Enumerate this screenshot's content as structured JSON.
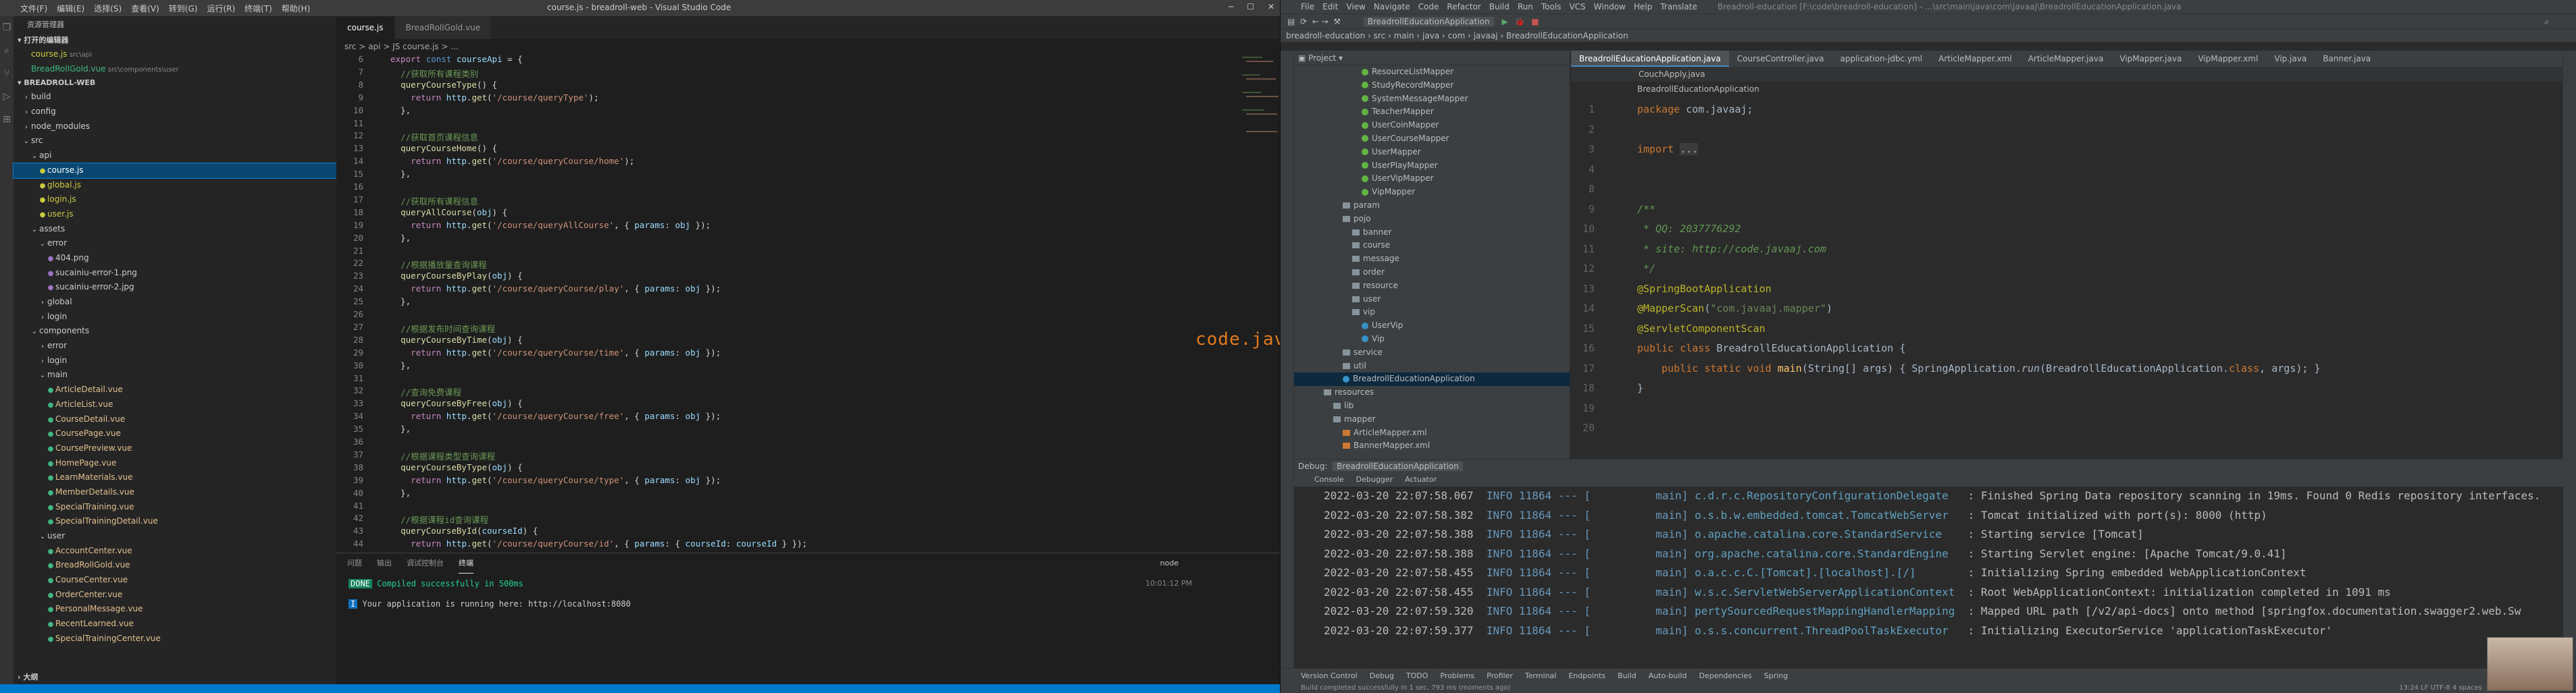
{
  "vscode": {
    "menu": [
      "文件(F)",
      "编辑(E)",
      "选择(S)",
      "查看(V)",
      "转到(G)",
      "运行(R)",
      "终端(T)",
      "帮助(H)"
    ],
    "window_title": "course.js - breadroll-web - Visual Studio Code",
    "explorer_title": "资源管理器",
    "open_editors": "打开的编辑器",
    "open_files": [
      {
        "name": "course.js",
        "path": "src\\api"
      },
      {
        "name": "BreadRollGold.vue",
        "path": "src\\components\\user"
      }
    ],
    "project": "BREADROLL-WEB",
    "tree": [
      {
        "l": "build",
        "d": 1,
        "t": "f"
      },
      {
        "l": "config",
        "d": 1,
        "t": "f"
      },
      {
        "l": "node_modules",
        "d": 1,
        "t": "f"
      },
      {
        "l": "src",
        "d": 1,
        "t": "fo"
      },
      {
        "l": "api",
        "d": 2,
        "t": "fo"
      },
      {
        "l": "course.js",
        "d": 3,
        "t": "js",
        "sel": true
      },
      {
        "l": "global.js",
        "d": 3,
        "t": "js"
      },
      {
        "l": "login.js",
        "d": 3,
        "t": "js"
      },
      {
        "l": "user.js",
        "d": 3,
        "t": "js"
      },
      {
        "l": "assets",
        "d": 2,
        "t": "fo"
      },
      {
        "l": "error",
        "d": 3,
        "t": "fo"
      },
      {
        "l": "404.png",
        "d": 4,
        "t": "img"
      },
      {
        "l": "sucainiu-error-1.png",
        "d": 4,
        "t": "img"
      },
      {
        "l": "sucainiu-error-2.jpg",
        "d": 4,
        "t": "img"
      },
      {
        "l": "global",
        "d": 3,
        "t": "f"
      },
      {
        "l": "login",
        "d": 3,
        "t": "f"
      },
      {
        "l": "components",
        "d": 2,
        "t": "fo"
      },
      {
        "l": "error",
        "d": 3,
        "t": "f"
      },
      {
        "l": "login",
        "d": 3,
        "t": "f"
      },
      {
        "l": "main",
        "d": 3,
        "t": "fo"
      },
      {
        "l": "ArticleDetail.vue",
        "d": 4,
        "t": "vue"
      },
      {
        "l": "ArticleList.vue",
        "d": 4,
        "t": "vue"
      },
      {
        "l": "CourseDetail.vue",
        "d": 4,
        "t": "vue"
      },
      {
        "l": "CoursePage.vue",
        "d": 4,
        "t": "vue"
      },
      {
        "l": "CoursePreview.vue",
        "d": 4,
        "t": "vue"
      },
      {
        "l": "HomePage.vue",
        "d": 4,
        "t": "vue"
      },
      {
        "l": "LearnMaterials.vue",
        "d": 4,
        "t": "vue"
      },
      {
        "l": "MemberDetails.vue",
        "d": 4,
        "t": "vue"
      },
      {
        "l": "SpecialTraining.vue",
        "d": 4,
        "t": "vue"
      },
      {
        "l": "SpecialTrainingDetail.vue",
        "d": 4,
        "t": "vue"
      },
      {
        "l": "user",
        "d": 3,
        "t": "fo"
      },
      {
        "l": "AccountCenter.vue",
        "d": 4,
        "t": "vue"
      },
      {
        "l": "BreadRollGold.vue",
        "d": 4,
        "t": "vue"
      },
      {
        "l": "CourseCenter.vue",
        "d": 4,
        "t": "vue"
      },
      {
        "l": "OrderCenter.vue",
        "d": 4,
        "t": "vue"
      },
      {
        "l": "PersonalMessage.vue",
        "d": 4,
        "t": "vue"
      },
      {
        "l": "RecentLearned.vue",
        "d": 4,
        "t": "vue"
      },
      {
        "l": "SpecialTrainingCenter.vue",
        "d": 4,
        "t": "vue"
      }
    ],
    "outline": "大纲",
    "tabs": [
      {
        "name": "course.js",
        "active": true
      },
      {
        "name": "BreadRollGold.vue",
        "active": false
      }
    ],
    "breadcrumb": "src > api > JS course.js > ...",
    "code": [
      {
        "n": "6",
        "h": "<span class='kw'>export</span> <span class='kw2'>const</span> <span class='var'>courseApi</span> = {"
      },
      {
        "n": "7",
        "h": "  <span class='cm'>//获取所有课程类别</span>"
      },
      {
        "n": "8",
        "h": "  <span class='fn'>queryCourseType</span>() {"
      },
      {
        "n": "9",
        "h": "    <span class='kw'>return</span> <span class='var'>http</span>.<span class='fn'>get</span>(<span class='str'>'/course/queryType'</span>);"
      },
      {
        "n": "10",
        "h": "  },"
      },
      {
        "n": "11",
        "h": ""
      },
      {
        "n": "12",
        "h": "  <span class='cm'>//获取首页课程信息</span>"
      },
      {
        "n": "13",
        "h": "  <span class='fn'>queryCourseHome</span>() {"
      },
      {
        "n": "14",
        "h": "    <span class='kw'>return</span> <span class='var'>http</span>.<span class='fn'>get</span>(<span class='str'>'/course/queryCourse/home'</span>);"
      },
      {
        "n": "15",
        "h": "  },"
      },
      {
        "n": "16",
        "h": ""
      },
      {
        "n": "17",
        "h": "  <span class='cm'>//获取所有课程信息</span>"
      },
      {
        "n": "18",
        "h": "  <span class='fn'>queryAllCourse</span>(<span class='var'>obj</span>) {"
      },
      {
        "n": "19",
        "h": "    <span class='kw'>return</span> <span class='var'>http</span>.<span class='fn'>get</span>(<span class='str'>'/course/queryAllCourse'</span>, { <span class='var'>params</span>: <span class='var'>obj</span> });"
      },
      {
        "n": "20",
        "h": "  },"
      },
      {
        "n": "21",
        "h": ""
      },
      {
        "n": "22",
        "h": "  <span class='cm'>//根据播放量查询课程</span>"
      },
      {
        "n": "23",
        "h": "  <span class='fn'>queryCourseByPlay</span>(<span class='var'>obj</span>) {"
      },
      {
        "n": "24",
        "h": "    <span class='kw'>return</span> <span class='var'>http</span>.<span class='fn'>get</span>(<span class='str'>'/course/queryCourse/play'</span>, { <span class='var'>params</span>: <span class='var'>obj</span> });"
      },
      {
        "n": "25",
        "h": "  },"
      },
      {
        "n": "26",
        "h": ""
      },
      {
        "n": "27",
        "h": "  <span class='cm'>//根据发布时间查询课程</span>"
      },
      {
        "n": "28",
        "h": "  <span class='fn'>queryCourseByTime</span>(<span class='var'>obj</span>) {"
      },
      {
        "n": "29",
        "h": "    <span class='kw'>return</span> <span class='var'>http</span>.<span class='fn'>get</span>(<span class='str'>'/course/queryCourse/time'</span>, { <span class='var'>params</span>: <span class='var'>obj</span> });"
      },
      {
        "n": "30",
        "h": "  },"
      },
      {
        "n": "31",
        "h": ""
      },
      {
        "n": "32",
        "h": "  <span class='cm'>//查询免费课程</span>"
      },
      {
        "n": "33",
        "h": "  <span class='fn'>queryCourseByFree</span>(<span class='var'>obj</span>) {"
      },
      {
        "n": "34",
        "h": "    <span class='kw'>return</span> <span class='var'>http</span>.<span class='fn'>get</span>(<span class='str'>'/course/queryCourse/free'</span>, { <span class='var'>params</span>: <span class='var'>obj</span> });"
      },
      {
        "n": "35",
        "h": "  },"
      },
      {
        "n": "36",
        "h": ""
      },
      {
        "n": "37",
        "h": "  <span class='cm'>//根据课程类型查询课程</span>"
      },
      {
        "n": "38",
        "h": "  <span class='fn'>queryCourseByType</span>(<span class='var'>obj</span>) {"
      },
      {
        "n": "39",
        "h": "    <span class='kw'>return</span> <span class='var'>http</span>.<span class='fn'>get</span>(<span class='str'>'/course/queryCourse/type'</span>, { <span class='var'>params</span>: <span class='var'>obj</span> });"
      },
      {
        "n": "40",
        "h": "  },"
      },
      {
        "n": "41",
        "h": ""
      },
      {
        "n": "42",
        "h": "  <span class='cm'>//根据课程id查询课程</span>"
      },
      {
        "n": "43",
        "h": "  <span class='fn'>queryCourseById</span>(<span class='var'>courseId</span>) {"
      },
      {
        "n": "44",
        "h": "    <span class='kw'>return</span> <span class='var'>http</span>.<span class='fn'>get</span>(<span class='str'>'/course/queryCourse/id'</span>, { <span class='var'>params</span>: { <span class='var'>courseId</span>: <span class='var'>courseId</span> } });"
      }
    ],
    "panel_tabs": [
      "问题",
      "输出",
      "调试控制台",
      "终端"
    ],
    "terminal_name": "node",
    "terminal_time": "10:01:12 PM",
    "done_badge": "DONE",
    "compiled": "Compiled successfully in 500ms",
    "info_badge": "I",
    "running": "Your application is running here: http://localhost:8080"
  },
  "watermark": "code.javaaj.com",
  "idea": {
    "menu": [
      "File",
      "Edit",
      "View",
      "Navigate",
      "Code",
      "Refactor",
      "Build",
      "Run",
      "Tools",
      "VCS",
      "Window",
      "Help",
      "Translate"
    ],
    "path": "Breadroll-education [F:\\code\\breadroll-education] - ...\\src\\main\\java\\com\\javaaj\\BreadrollEducationApplication.java",
    "run_config": "BreadrollEducationApplication",
    "breadcrumb": [
      "breadroll-education",
      "src",
      "main",
      "java",
      "com",
      "javaaj",
      "BreadrollEducationApplication"
    ],
    "project_label": "Project",
    "tree": [
      {
        "l": "ResourceListMapper",
        "d": 5,
        "t": "i"
      },
      {
        "l": "StudyRecordMapper",
        "d": 5,
        "t": "i"
      },
      {
        "l": "SystemMessageMapper",
        "d": 5,
        "t": "i"
      },
      {
        "l": "TeacherMapper",
        "d": 5,
        "t": "i"
      },
      {
        "l": "UserCoinMapper",
        "d": 5,
        "t": "i"
      },
      {
        "l": "UserCourseMapper",
        "d": 5,
        "t": "i"
      },
      {
        "l": "UserMapper",
        "d": 5,
        "t": "i"
      },
      {
        "l": "UserPlayMapper",
        "d": 5,
        "t": "i"
      },
      {
        "l": "UserVipMapper",
        "d": 5,
        "t": "i"
      },
      {
        "l": "VipMapper",
        "d": 5,
        "t": "i"
      },
      {
        "l": "param",
        "d": 3,
        "t": "f"
      },
      {
        "l": "pojo",
        "d": 3,
        "t": "f"
      },
      {
        "l": "banner",
        "d": 4,
        "t": "f"
      },
      {
        "l": "course",
        "d": 4,
        "t": "f"
      },
      {
        "l": "message",
        "d": 4,
        "t": "f"
      },
      {
        "l": "order",
        "d": 4,
        "t": "f"
      },
      {
        "l": "resource",
        "d": 4,
        "t": "f"
      },
      {
        "l": "user",
        "d": 4,
        "t": "f"
      },
      {
        "l": "vip",
        "d": 4,
        "t": "f"
      },
      {
        "l": "UserVip",
        "d": 5,
        "t": "c"
      },
      {
        "l": "Vip",
        "d": 5,
        "t": "c"
      },
      {
        "l": "service",
        "d": 3,
        "t": "f"
      },
      {
        "l": "util",
        "d": 3,
        "t": "f"
      },
      {
        "l": "BreadrollEducationApplication",
        "d": 3,
        "t": "c",
        "sel": true
      },
      {
        "l": "resources",
        "d": 1,
        "t": "f"
      },
      {
        "l": "lib",
        "d": 2,
        "t": "f"
      },
      {
        "l": "mapper",
        "d": 2,
        "t": "f"
      },
      {
        "l": "ArticleMapper.xml",
        "d": 3,
        "t": "x"
      },
      {
        "l": "BannerMapper.xml",
        "d": 3,
        "t": "x"
      }
    ],
    "tabs": [
      {
        "n": "BreadrollEducationApplication.java",
        "on": true
      },
      {
        "n": "CourseController.java"
      },
      {
        "n": "application-jdbc.yml"
      },
      {
        "n": "ArticleMapper.xml"
      },
      {
        "n": "ArticleMapper.java"
      },
      {
        "n": "VipMapper.java"
      },
      {
        "n": "VipMapper.xml"
      },
      {
        "n": "Vip.java"
      },
      {
        "n": "Banner.java"
      }
    ],
    "subtab": "CouchApply.java",
    "class_header": "BreadrollEducationApplication",
    "code": [
      {
        "n": "1",
        "h": "<span class='ikw'>package</span> com.javaaj;"
      },
      {
        "n": "2",
        "h": ""
      },
      {
        "n": "3",
        "h": "<span class='ikw'>import</span> <span style='background:#3b3b3b'>...</span>"
      },
      {
        "n": "4",
        "h": ""
      },
      {
        "n": "8",
        "h": ""
      },
      {
        "n": "9",
        "h": "<span class='icm'>/**</span>"
      },
      {
        "n": "10",
        "h": "<span class='icm'> * QQ: 2037776292</span>"
      },
      {
        "n": "11",
        "h": "<span class='icm'> * site: http://code.javaaj.com</span>"
      },
      {
        "n": "12",
        "h": "<span class='icm'> */</span>"
      },
      {
        "n": "13",
        "h": "<span class='iann'>@SpringBootApplication</span>"
      },
      {
        "n": "14",
        "h": "<span class='iann'>@MapperScan</span>(<span class='istr'>\"com.javaaj.mapper\"</span>)"
      },
      {
        "n": "15",
        "h": "<span class='iann'>@ServletComponentScan</span>"
      },
      {
        "n": "16",
        "h": "<span class='ikw'>public class</span> BreadrollEducationApplication {"
      },
      {
        "n": "17",
        "h": "    <span class='ikw'>public static void</span> <span class='ifn'>main</span>(String[] args) { SpringApplication.<i>run</i>(BreadrollEducationApplication.<span class='ikw'>class</span>, args); }"
      },
      {
        "n": "18",
        "h": "}"
      },
      {
        "n": "19",
        "h": ""
      },
      {
        "n": "20",
        "h": ""
      }
    ],
    "debug_label": "Debug:",
    "debug_config": "BreadrollEducationApplication",
    "debug_tabs": [
      "Console",
      "Debugger",
      "Actuator"
    ],
    "log": [
      {
        "d": "2022-03-20 22:07:58.067",
        "lv": "INFO",
        "pid": "11864",
        "th": "main",
        "c": "c.d.r.c.RepositoryConfigurationDelegate",
        "m": ": Finished Spring Data repository scanning in 19ms. Found 0 Redis repository interfaces."
      },
      {
        "d": "2022-03-20 22:07:58.382",
        "lv": "INFO",
        "pid": "11864",
        "th": "main",
        "c": "o.s.b.w.embedded.tomcat.TomcatWebServer",
        "m": ": Tomcat initialized with port(s): 8000 (http)"
      },
      {
        "d": "2022-03-20 22:07:58.388",
        "lv": "INFO",
        "pid": "11864",
        "th": "main",
        "c": "o.apache.catalina.core.StandardService",
        "m": ": Starting service [Tomcat]"
      },
      {
        "d": "2022-03-20 22:07:58.388",
        "lv": "INFO",
        "pid": "11864",
        "th": "main",
        "c": "org.apache.catalina.core.StandardEngine",
        "m": ": Starting Servlet engine: [Apache Tomcat/9.0.41]"
      },
      {
        "d": "2022-03-20 22:07:58.455",
        "lv": "INFO",
        "pid": "11864",
        "th": "main",
        "c": "o.a.c.c.C.[Tomcat].[localhost].[/]",
        "m": ": Initializing Spring embedded WebApplicationContext"
      },
      {
        "d": "2022-03-20 22:07:58.455",
        "lv": "INFO",
        "pid": "11864",
        "th": "main",
        "c": "w.s.c.ServletWebServerApplicationContext",
        "m": ": Root WebApplicationContext: initialization completed in 1091 ms"
      },
      {
        "d": "2022-03-20 22:07:59.320",
        "lv": "INFO",
        "pid": "11864",
        "th": "main",
        "c": "pertySourcedRequestMappingHandlerMapping",
        "m": ": Mapped URL path [/v2/api-docs] onto method [springfox.documentation.swagger2.web.Sw"
      },
      {
        "d": "2022-03-20 22:07:59.377",
        "lv": "INFO",
        "pid": "11864",
        "th": "main",
        "c": "o.s.s.concurrent.ThreadPoolTaskExecutor",
        "m": ": Initializing ExecutorService 'applicationTaskExecutor'"
      }
    ],
    "bottom_tabs": [
      "Version Control",
      "Debug",
      "TODO",
      "Problems",
      "Profiler",
      "Terminal",
      "Endpoints",
      "Build",
      "Auto-build",
      "Dependencies",
      "Spring"
    ],
    "status": "Build completed successfully in 1 sec, 793 ms (moments ago)",
    "status_right": "13:24  LF  UTF-8  4 spaces"
  }
}
